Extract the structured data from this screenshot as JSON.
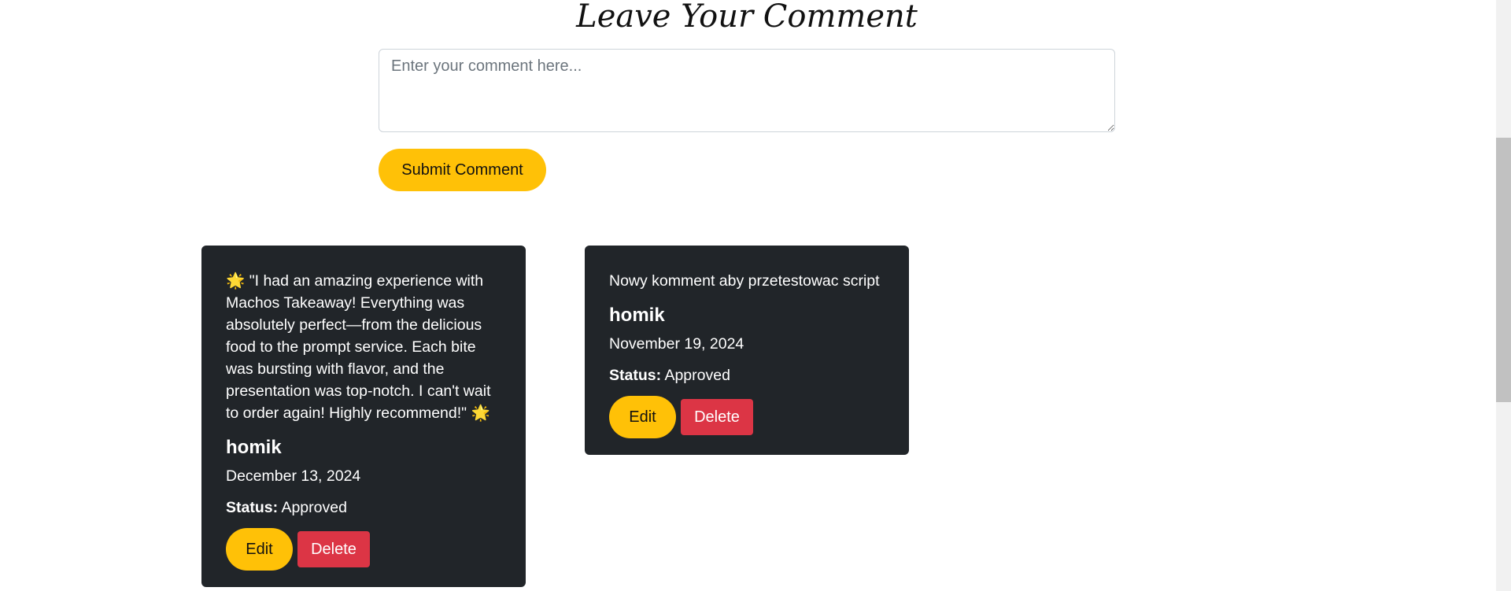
{
  "comment_form": {
    "heading": "Leave Your Comment",
    "textarea_placeholder": "Enter your comment here...",
    "textarea_value": "",
    "submit_label": "Submit Comment"
  },
  "comments": [
    {
      "text": "🌟 \"I had an amazing experience with Machos Takeaway! Everything was absolutely perfect—from the delicious food to the prompt service. Each bite was bursting with flavor, and the presentation was top-notch. I can't wait to order again! Highly recommend!\" 🌟",
      "author": "homik",
      "date": "December 13, 2024",
      "status_label": "Status:",
      "status_value": "Approved",
      "edit_label": "Edit",
      "delete_label": "Delete"
    },
    {
      "text": "Nowy komment aby przetestowac script",
      "author": "homik",
      "date": "November 19, 2024",
      "status_label": "Status:",
      "status_value": "Approved",
      "edit_label": "Edit",
      "delete_label": "Delete"
    }
  ],
  "colors": {
    "accent": "#ffc107",
    "danger": "#dc3545",
    "card_bg": "#212529"
  }
}
